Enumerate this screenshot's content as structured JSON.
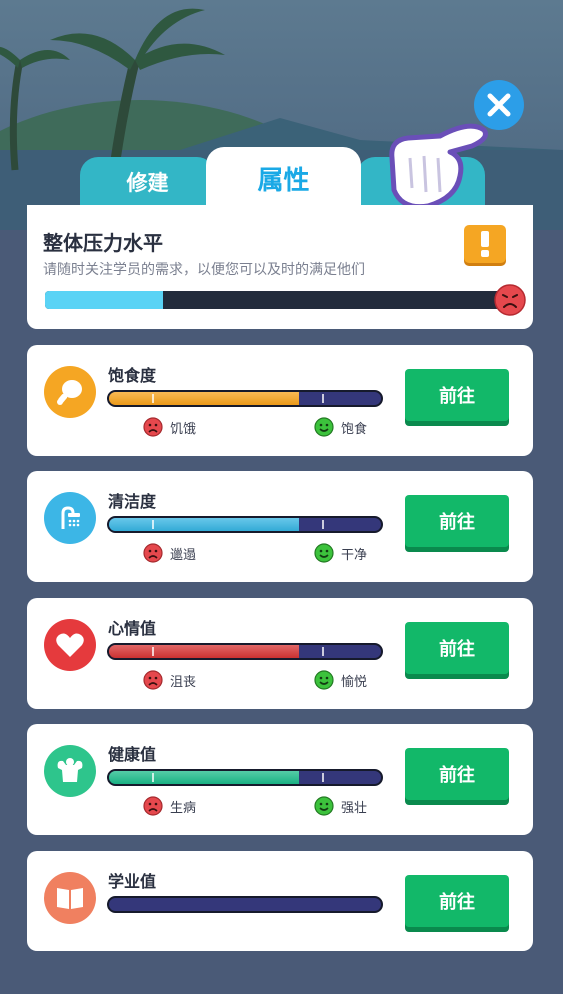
{
  "tabs": [
    {
      "label": "修建",
      "active": false
    },
    {
      "label": "属性",
      "active": true
    }
  ],
  "close_icon": "close-icon",
  "pressure": {
    "title": "整体压力水平",
    "subtitle": "请随时关注学员的需求，以便您可以及时的满足他们",
    "level": 0.25,
    "warning_icon": "exclamation-icon",
    "status_icon": "sad-face-icon"
  },
  "stats": [
    {
      "title": "饱食度",
      "icon": "drumstick-icon",
      "color": "#f5a623",
      "fill": 0.7,
      "fill_color": "#f7a21b",
      "low_label": "饥饿",
      "high_label": "饱食",
      "button": "前往"
    },
    {
      "title": "清洁度",
      "icon": "shower-icon",
      "color": "#3cb6e6",
      "fill": 0.7,
      "fill_color": "#36b4e2",
      "low_label": "邋遢",
      "high_label": "干净",
      "button": "前往"
    },
    {
      "title": "心情值",
      "icon": "heart-icon",
      "color": "#e53a3d",
      "fill": 0.7,
      "fill_color": "#d63434",
      "low_label": "沮丧",
      "high_label": "愉悦",
      "button": "前往"
    },
    {
      "title": "健康值",
      "icon": "muscle-icon",
      "color": "#2ec58c",
      "fill": 0.7,
      "fill_color": "#1cbb8a",
      "low_label": "生病",
      "high_label": "强壮",
      "button": "前往"
    },
    {
      "title": "学业值",
      "icon": "book-icon",
      "color": "#f08060",
      "fill": 0,
      "fill_color": "#34377a",
      "button": "前往"
    }
  ],
  "colors": {
    "accent": "#1aa9e6",
    "go_button": "#12b869",
    "sad_face": "#e5484d",
    "happy_face": "#3cc23c"
  }
}
